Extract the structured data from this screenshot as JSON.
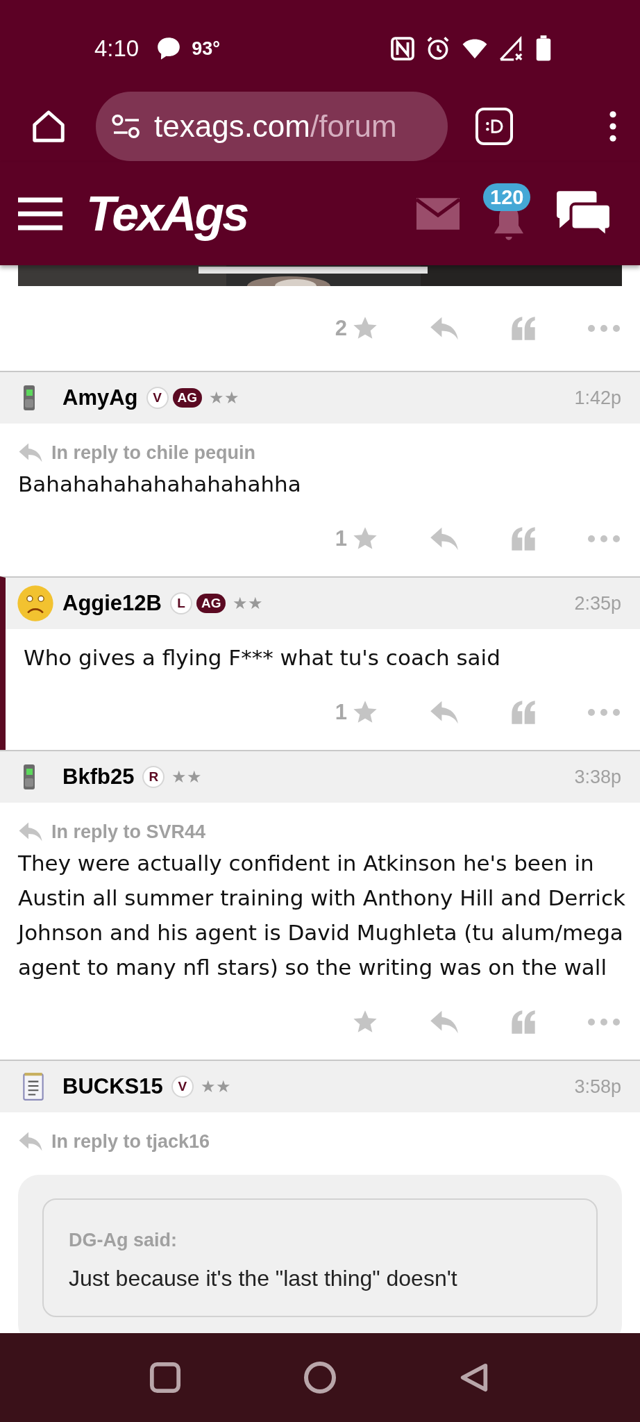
{
  "status_bar": {
    "time": "4:10",
    "temperature": "93°"
  },
  "browser": {
    "url_host": "texags.com",
    "url_path": "/forum"
  },
  "site_header": {
    "logo": "TexAgs",
    "notification_count": "120"
  },
  "previous_post": {
    "star_count": "2"
  },
  "posts": [
    {
      "avatar": {
        "kind": "phone"
      },
      "user": "AmyAg",
      "badges": [
        {
          "label": "V",
          "kind": "outline"
        },
        {
          "label": "AG",
          "kind": "filled"
        }
      ],
      "rank": "★★",
      "time": "1:42p",
      "highlighted": false,
      "reply_to": "In reply to chile pequin",
      "body": "Bahahahahahahahahahha",
      "star_count": "1"
    },
    {
      "avatar": {
        "kind": "sad-face"
      },
      "user": "Aggie12B",
      "badges": [
        {
          "label": "L",
          "kind": "outline"
        },
        {
          "label": "AG",
          "kind": "filled"
        }
      ],
      "rank": "★★",
      "time": "2:35p",
      "highlighted": true,
      "body": "Who gives a flying F*** what tu's coach said",
      "star_count": "1"
    },
    {
      "avatar": {
        "kind": "phone"
      },
      "user": "Bkfb25",
      "badges": [
        {
          "label": "R",
          "kind": "outline"
        }
      ],
      "rank": "★★",
      "time": "3:38p",
      "highlighted": false,
      "reply_to": "In reply to SVR44",
      "body": "They were actually confident in Atkinson he's been in Austin all summer training with Anthony Hill and Derrick Johnson and his agent is David Mughleta (tu alum/mega agent to many nfl stars) so the writing was on the wall"
    },
    {
      "avatar": {
        "kind": "notepad"
      },
      "user": "BUCKS15",
      "badges": [
        {
          "label": "V",
          "kind": "outline"
        }
      ],
      "rank": "★★",
      "time": "3:58p",
      "highlighted": false,
      "reply_to": "In reply to tjack16",
      "quote": {
        "author": "DG-Ag said:",
        "text": "Just because it's the \"last thing\" doesn't"
      }
    }
  ]
}
